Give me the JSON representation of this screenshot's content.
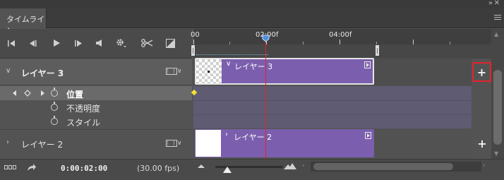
{
  "panel": {
    "tab_label": "タイムライン",
    "collapse_icon": "double-chevron-right-icon",
    "close_icon": "close-icon",
    "menu_icon": "panel-menu-icon"
  },
  "toolbar": {
    "buttons": [
      {
        "name": "go-to-first-frame-button",
        "icon": "skip-to-start-icon"
      },
      {
        "name": "previous-frame-button",
        "icon": "step-back-icon"
      },
      {
        "name": "play-button",
        "icon": "play-icon"
      },
      {
        "name": "next-frame-button",
        "icon": "step-forward-icon"
      },
      {
        "name": "audio-button",
        "icon": "speaker-icon"
      },
      {
        "name": "settings-button",
        "icon": "gear-icon"
      },
      {
        "name": "split-button",
        "icon": "scissors-icon"
      },
      {
        "name": "transition-button",
        "icon": "transition-icon"
      }
    ]
  },
  "ruler": {
    "labels": [
      "00",
      "02:00f",
      "04:00f"
    ]
  },
  "layers": [
    {
      "name": "レイヤー 3",
      "expanded": true,
      "properties": [
        {
          "label": "位置",
          "selected": true,
          "has_keyframe": true
        },
        {
          "label": "不透明度",
          "selected": false
        },
        {
          "label": "スタイル",
          "selected": false
        }
      ]
    },
    {
      "name": "レイヤー 2",
      "expanded": false
    }
  ],
  "clips": [
    {
      "label": "レイヤー 3",
      "thumbnail": "transparent-checker"
    },
    {
      "label": "レイヤー 2",
      "thumbnail": "white"
    }
  ],
  "add_button_label": "+",
  "bottom": {
    "timecode": "0:00:02:00",
    "fps": "(30.00 fps)"
  },
  "colors": {
    "clip": "#7b5fae",
    "playhead": "#e8202a",
    "highlight": "#e5232c",
    "keyframe": "#f2e03a"
  }
}
